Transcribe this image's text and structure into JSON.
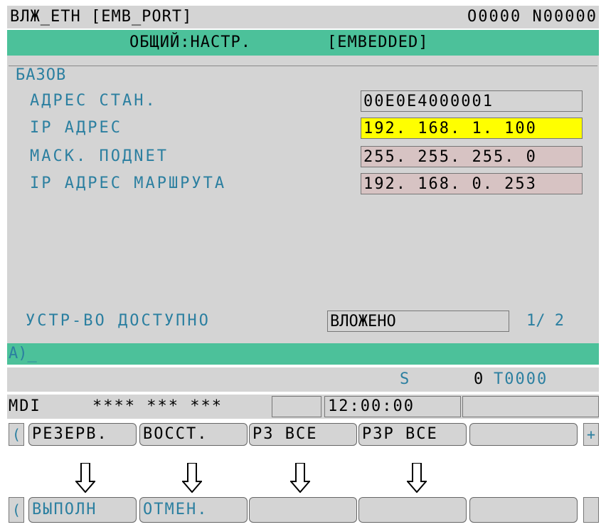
{
  "header": {
    "left": "ВЛЖ_ETH  [EMB_PORT]",
    "right": "O0000 N00000"
  },
  "titlebar": {
    "left": "ОБЩИЙ:НАСТР.",
    "right": "[EMBEDDED]"
  },
  "group": {
    "title": "БАЗОВ",
    "fields": [
      {
        "label": "АДРЕС СТАН.",
        "value": "00E0E4000001"
      },
      {
        "label": "IP АДРЕС",
        "value": "192. 168. 1. 100"
      },
      {
        "label": "МАСК. ПОДNET",
        "value": "255. 255. 255. 0"
      },
      {
        "label": "IP АДРЕС МАРШРУТА",
        "value": "192. 168. 0. 253"
      }
    ]
  },
  "device": {
    "label": "УСТР-ВО ДОСТУПНО",
    "value": "ВЛОЖЕНО",
    "page": "1/ 2"
  },
  "input_line": "A)_",
  "s_row": {
    "s": "S",
    "zero": "0",
    "t": "T0000"
  },
  "status": {
    "mode": "MDI",
    "stars": "**** *** ***",
    "time": "12:00:00"
  },
  "softkeys": {
    "left_arrow": "(",
    "keys": [
      "РЕЗЕРВ.",
      "ВОССТ.",
      "РЗ ВСЕ",
      "РЗР ВСЕ",
      ""
    ],
    "plus": "+"
  },
  "softkeys_bottom": {
    "left_arrow": "(",
    "keys": [
      "ВЫПОЛН",
      "ОТМЕН.",
      "",
      "",
      ""
    ]
  },
  "colors": {
    "accent_green": "#4cc19a",
    "highlight_yellow": "#ffff00",
    "field_pink": "#d7c3c3",
    "label_blue": "#2b7fa0",
    "panel_gray": "#d4d4d4"
  }
}
